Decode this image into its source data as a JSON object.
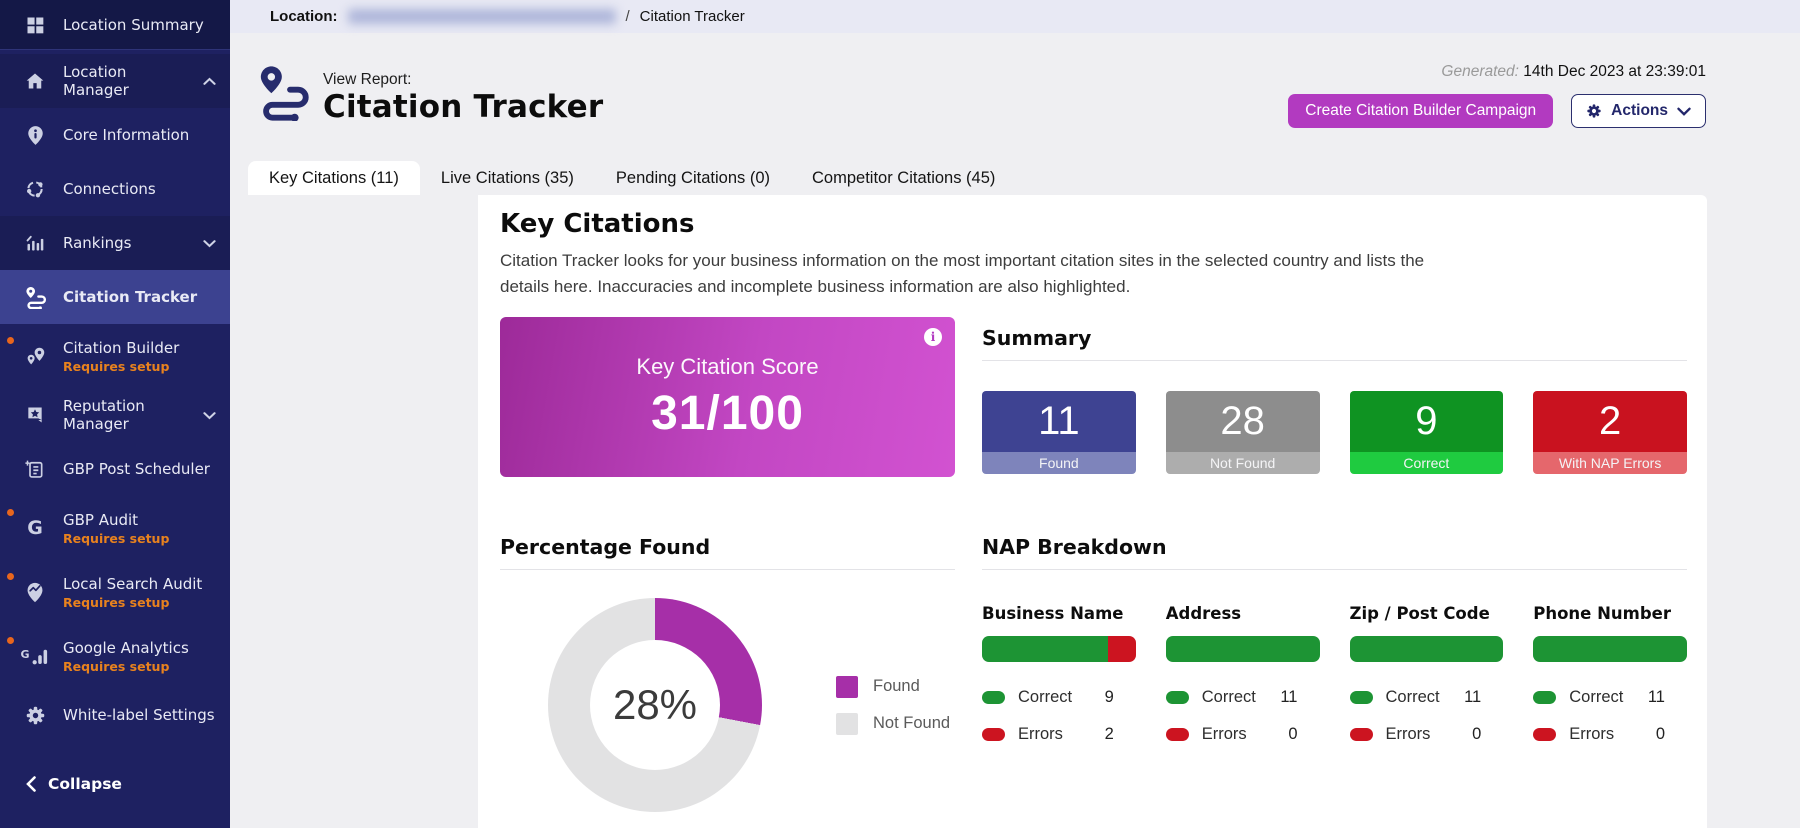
{
  "sidebar": {
    "items": [
      {
        "label": "Location Summary",
        "icon": "grid-icon"
      },
      {
        "label": "Location Manager",
        "icon": "home-icon",
        "chevron": "up"
      },
      {
        "label": "Core Information",
        "icon": "info-pin-icon"
      },
      {
        "label": "Connections",
        "icon": "connections-icon"
      },
      {
        "label": "Rankings",
        "icon": "rankings-icon",
        "chevron": "down"
      },
      {
        "label": "Citation Tracker",
        "icon": "route-icon",
        "active": true
      },
      {
        "label": "Citation Builder",
        "icon": "map-pins-icon",
        "badge": "Requires setup"
      },
      {
        "label": "Reputation Manager",
        "icon": "bookmark-star-icon",
        "chevron": "down"
      },
      {
        "label": "GBP Post Scheduler",
        "icon": "post-list-icon"
      },
      {
        "label": "GBP Audit",
        "icon": "google-g-icon",
        "badge": "Requires setup"
      },
      {
        "label": "Local Search Audit",
        "icon": "search-pin-icon",
        "badge": "Requires setup"
      },
      {
        "label": "Google Analytics",
        "icon": "analytics-bars-icon",
        "badge": "Requires setup"
      },
      {
        "label": "White-label Settings",
        "icon": "gear-icon"
      }
    ],
    "collapse_label": "Collapse"
  },
  "breadcrumb": {
    "location_label": "Location:",
    "separator": "/",
    "current": "Citation Tracker"
  },
  "header": {
    "view_report_label": "View Report:",
    "title": "Citation Tracker",
    "generated_label": "Generated:",
    "generated_value": "14th Dec 2023 at 23:39:01",
    "create_campaign_button": "Create Citation Builder Campaign",
    "actions_button": "Actions"
  },
  "tabs": [
    {
      "label": "Key Citations (11)",
      "active": true
    },
    {
      "label": "Live Citations (35)",
      "active": false
    },
    {
      "label": "Pending Citations (0)",
      "active": false
    },
    {
      "label": "Competitor Citations (45)",
      "active": false
    }
  ],
  "key_citations": {
    "heading": "Key Citations",
    "description": "Citation Tracker looks for your business information on the most important citation sites in the selected country and lists the details here. Inaccuracies and incomplete business information are also highlighted.",
    "score_card": {
      "label": "Key Citation Score",
      "value": "31/100",
      "info_icon": "info-icon"
    },
    "summary": {
      "heading": "Summary",
      "boxes": [
        {
          "value": "11",
          "label": "Found",
          "color": "#3e4392",
          "label_color": "#7e84bb"
        },
        {
          "value": "28",
          "label": "Not Found",
          "color": "#8d8d8d",
          "label_color": "#adadad"
        },
        {
          "value": "9",
          "label": "Correct",
          "color": "#0f9322",
          "label_color": "#1fcb40"
        },
        {
          "value": "2",
          "label": "With NAP Errors",
          "color": "#c9121f",
          "label_color": "#e5676c"
        }
      ]
    },
    "percentage_found": {
      "heading": "Percentage Found",
      "value": "28%",
      "legend": [
        {
          "label": "Found",
          "color": "#a62fa8"
        },
        {
          "label": "Not Found",
          "color": "#e2e2e3"
        }
      ]
    },
    "nap_breakdown": {
      "heading": "NAP Breakdown",
      "correct_label": "Correct",
      "errors_label": "Errors",
      "columns": [
        {
          "title": "Business Name",
          "correct": 9,
          "errors": 2
        },
        {
          "title": "Address",
          "correct": 11,
          "errors": 0
        },
        {
          "title": "Zip / Post Code",
          "correct": 11,
          "errors": 0
        },
        {
          "title": "Phone Number",
          "correct": 11,
          "errors": 0
        }
      ]
    }
  },
  "chart_data": [
    {
      "type": "pie",
      "title": "Percentage Found",
      "labels": [
        "Found",
        "Not Found"
      ],
      "values": [
        28,
        72
      ],
      "colors": [
        "#a62fa8",
        "#e2e2e3"
      ],
      "donut": true,
      "center_label": "28%",
      "legend_position": "right"
    },
    {
      "type": "bar",
      "title": "NAP Breakdown",
      "categories": [
        "Business Name",
        "Address",
        "Zip / Post Code",
        "Phone Number"
      ],
      "series": [
        {
          "name": "Correct",
          "color": "#1d9434",
          "values": [
            9,
            11,
            11,
            11
          ]
        },
        {
          "name": "Errors",
          "color": "#cc1420",
          "values": [
            2,
            0,
            0,
            0
          ]
        }
      ]
    }
  ]
}
